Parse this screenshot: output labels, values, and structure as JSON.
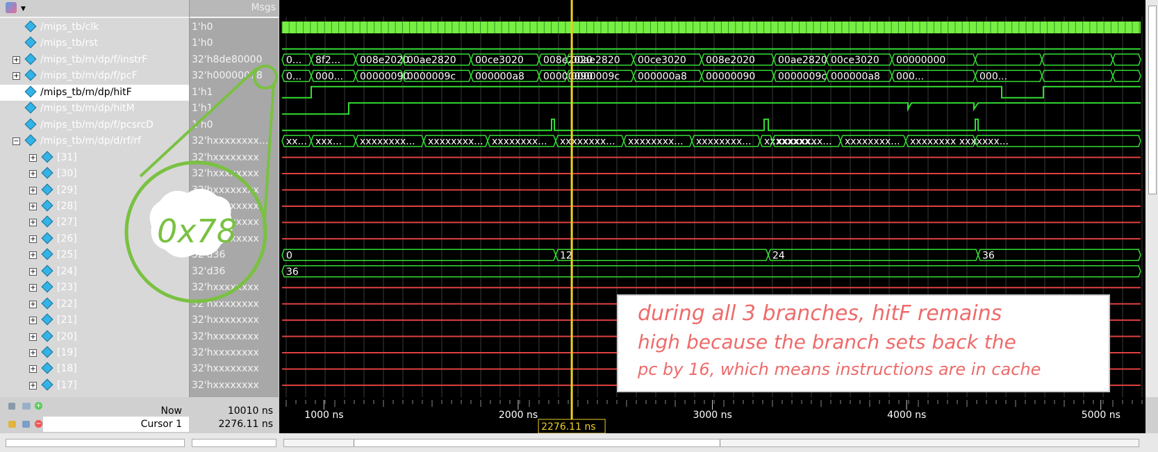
{
  "header": {
    "msgs_label": "Msgs"
  },
  "signals": [
    {
      "name": "/mips_tb/clk",
      "value": "1'h0",
      "expand": false
    },
    {
      "name": "/mips_tb/rst",
      "value": "1'h0",
      "expand": false
    },
    {
      "name": "/mips_tb/m/dp/f/instrF",
      "value": "32'h8de80000",
      "expand": true
    },
    {
      "name": "/mips_tb/m/dp/f/pcF",
      "value": "32'h00000078",
      "expand": true
    },
    {
      "name": "/mips_tb/m/dp/hitF",
      "value": "1'h1",
      "expand": false,
      "selected": true
    },
    {
      "name": "/mips_tb/m/dp/hitM",
      "value": "1'h1",
      "expand": false
    },
    {
      "name": "/mips_tb/m/dp/f/pcsrcD",
      "value": "1'h0",
      "expand": false
    },
    {
      "name": "/mips_tb/m/dp/d/rf/rf",
      "value": "32'hxxxxxxxx...",
      "expand": true,
      "open": true
    },
    {
      "name": "[31]",
      "value": "32'hxxxxxxxx",
      "sub": true
    },
    {
      "name": "[30]",
      "value": "32'hxxxxxxxx",
      "sub": true
    },
    {
      "name": "[29]",
      "value": "32'hxxxxxxxx",
      "sub": true
    },
    {
      "name": "[28]",
      "value": "32'hxxxxxxxx",
      "sub": true
    },
    {
      "name": "[27]",
      "value": "32'hxxxxxxxx",
      "sub": true
    },
    {
      "name": "[26]",
      "value": "32'hxxxxxxxx",
      "sub": true
    },
    {
      "name": "[25]",
      "value": "32'd36",
      "sub": true
    },
    {
      "name": "[24]",
      "value": "32'd36",
      "sub": true
    },
    {
      "name": "[23]",
      "value": "32'hxxxxxxxx",
      "sub": true
    },
    {
      "name": "[22]",
      "value": "32'hxxxxxxxx",
      "sub": true
    },
    {
      "name": "[21]",
      "value": "32'hxxxxxxxx",
      "sub": true
    },
    {
      "name": "[20]",
      "value": "32'hxxxxxxxx",
      "sub": true
    },
    {
      "name": "[19]",
      "value": "32'hxxxxxxxx",
      "sub": true
    },
    {
      "name": "[18]",
      "value": "32'hxxxxxxxx",
      "sub": true
    },
    {
      "name": "[17]",
      "value": "32'hxxxxxxxx",
      "sub": true
    }
  ],
  "bus_labels": {
    "instrF": [
      "0...",
      "8f2...",
      "008e2020",
      "00ae2820",
      "00ce3020",
      "008e2020",
      "00ae2820",
      "00ce3020",
      "008e2020",
      "00ae2820",
      "00ce3020",
      "00000000"
    ],
    "pcF": [
      "0...",
      "000...",
      "00000090",
      "0000009c",
      "000000a8",
      "00000090",
      "0000009c",
      "000000a8",
      "00000090",
      "0000009c",
      "000000a8",
      "000...",
      "000..."
    ],
    "rf": [
      "xx...",
      "xxx...",
      "xxxxxxxx...",
      "xxxxxxxx...",
      "xxxxxxxx...",
      "xxxxxxxx...",
      "xxxxxxxx...",
      "xxxxxxxx...",
      "xxxxxxxx...",
      "xxxxxxxx...",
      "xxxxxxxx...",
      "xxxxxxxx xxxxxxx..."
    ],
    "r25": [
      "0",
      "12",
      "24",
      "36"
    ],
    "r24": [
      "36"
    ]
  },
  "timeline": {
    "ticks": [
      "1000 ns",
      "2000 ns",
      "3000 ns",
      "4000 ns",
      "5000 ns"
    ],
    "now_label": "Now",
    "now_value": "10010 ns",
    "cursor_label": "Cursor 1",
    "cursor_value": "2276.11 ns",
    "cursor_time_ns": 2276.11,
    "view_range_ns": [
      770,
      5230
    ]
  },
  "annotations": {
    "circle_label": "0x78",
    "note_lines": [
      "during all 3 branches, hitF remains",
      "high because the branch sets back the",
      "pc by 16, which means instructions are in cache"
    ]
  },
  "colors": {
    "wave": "#33dd33",
    "clk_fill": "#77ee44",
    "red_line": "#e04040",
    "cursor": "#f0d020",
    "annot": "#7ac142",
    "note_text": "#ee6a6a"
  }
}
